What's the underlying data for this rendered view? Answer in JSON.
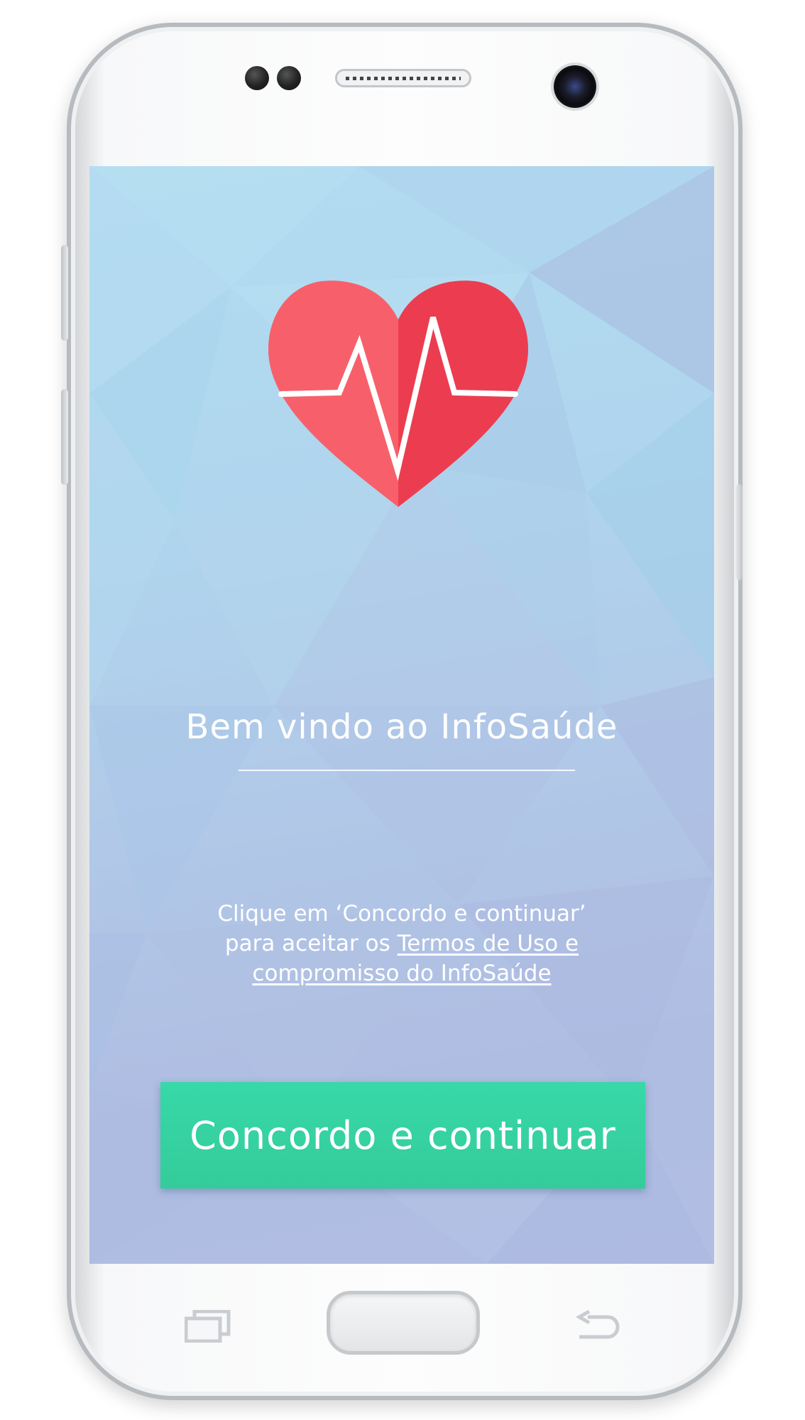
{
  "screen": {
    "logo_icon": "heart-pulse-icon",
    "title": "Bem vindo ao InfoSaúde",
    "terms": {
      "line1": "Clique em ‘Concordo e continuar’",
      "line2_prefix": "para aceitar os",
      "terms_link_part1": "Termos de Uso e",
      "terms_link_part2": "compromisso do InfoSaúde"
    },
    "agree_button_label": "Concordo e continuar"
  },
  "device": {
    "nav_keys": [
      "recents-icon",
      "home-button",
      "back-icon"
    ]
  },
  "colors": {
    "heart_light": "#f7606a",
    "heart_dark": "#ec3d50",
    "button": "#36d3a2",
    "background_top": "#b2dbf0",
    "background_bottom": "#b2bde3"
  }
}
